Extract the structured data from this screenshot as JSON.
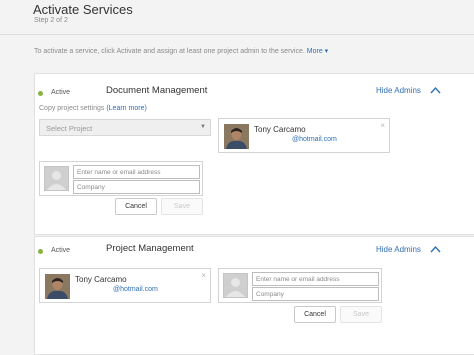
{
  "header": {
    "title": "Activate Services",
    "subtitle": "Step 2 of 2"
  },
  "intro": {
    "text": "To activate a service, click Activate and assign at least one project admin to the service.",
    "more": "More ▾"
  },
  "services": [
    {
      "status": "Active",
      "name": "Document Management",
      "hide_admins": "Hide Admins",
      "copy_settings": {
        "label": "Copy project settings",
        "link": "(Learn more)"
      },
      "select": {
        "value": "Select Project"
      },
      "admin": {
        "name": "Tony Carcamo",
        "email": "@hotmail.com"
      },
      "new_admin": {
        "email_placeholder": "Enter name or email address",
        "company_placeholder": "Company"
      },
      "buttons": {
        "cancel": "Cancel",
        "save": "Save"
      }
    },
    {
      "status": "Active",
      "name": "Project Management",
      "hide_admins": "Hide Admins",
      "admin": {
        "name": "Tony Carcamo",
        "email": "@hotmail.com"
      },
      "new_admin": {
        "email_placeholder": "Enter name or email address",
        "company_placeholder": "Company"
      },
      "buttons": {
        "cancel": "Cancel",
        "save": "Save"
      }
    }
  ],
  "colors": {
    "link": "#2f6fb5",
    "active_dot": "#87b340",
    "page_bg": "#f3f3f3"
  },
  "icons": {
    "close": "×",
    "collapse": "chevron-up-icon",
    "dropdown": "▼"
  }
}
